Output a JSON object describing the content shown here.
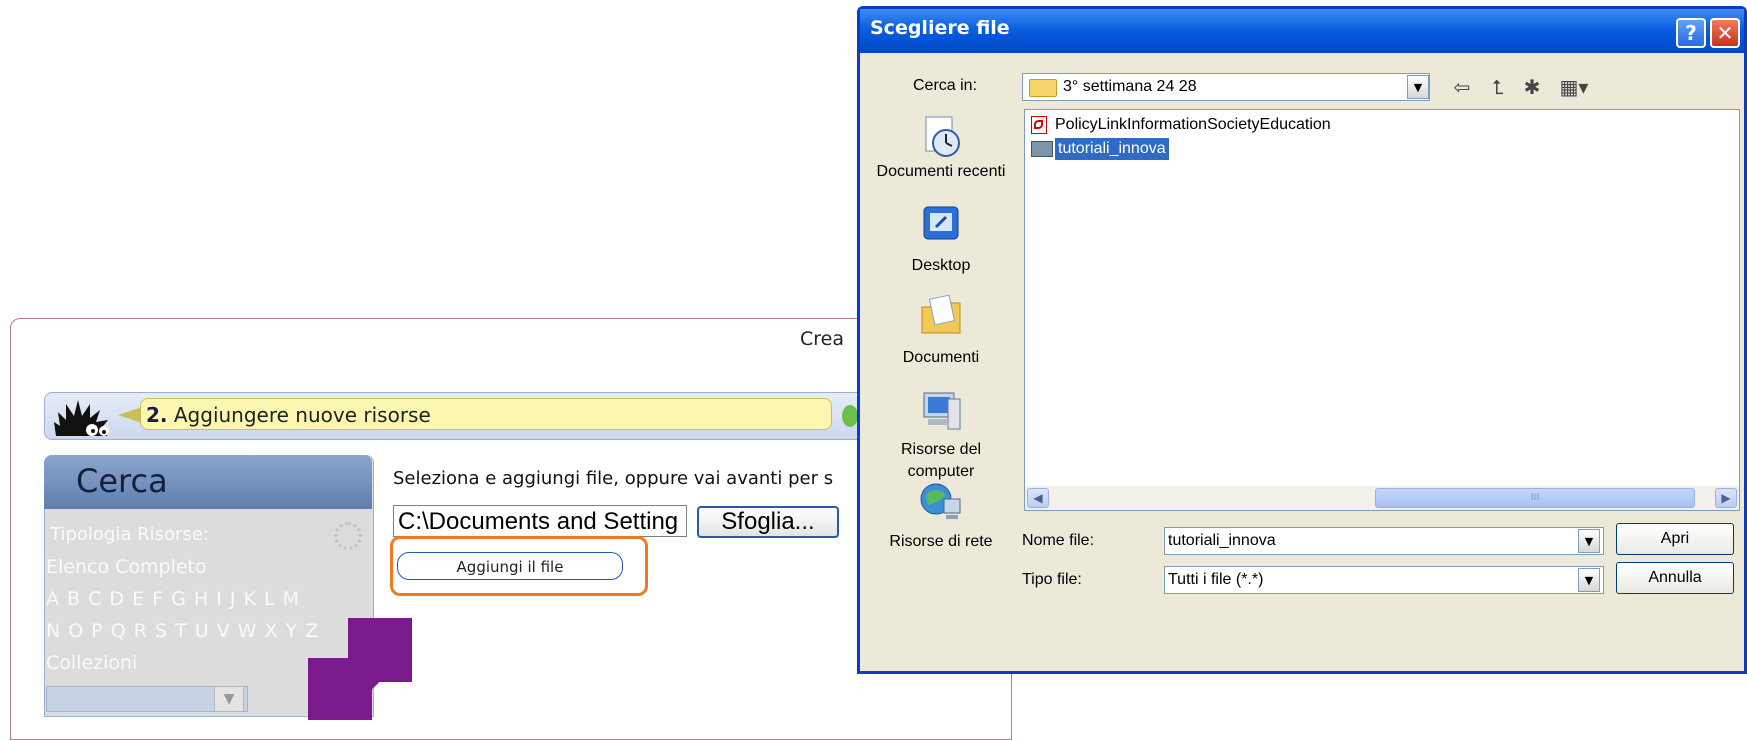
{
  "app": {
    "title": "Crea",
    "step_number": "2.",
    "step_label": "Aggiungere nuove risorse",
    "search": {
      "title": "Cerca",
      "type_label": "Tipologia Risorse:",
      "full_list": "Elenco Completo",
      "letters_row1": "A B C D E F G H I J  K L M",
      "letters_row2": "N O P Q R S T U V W X Y Z",
      "collections": "Collezioni"
    },
    "instruction": "Seleziona e aggiungi file, oppure vai avanti per s",
    "path_value": "C:\\Documents and Setting",
    "browse_label": "Sfoglia...",
    "add_file_label": "Aggiungi il file",
    "colors": {
      "highlight": "#f27921",
      "arrow": "#7a1a8c"
    }
  },
  "dialog": {
    "title": "Scegliere file",
    "help_glyph": "?",
    "close_glyph": "✕",
    "look_in_label": "Cerca in:",
    "look_in_value": "3° settimana 24 28",
    "places": [
      {
        "label": "Documenti recenti",
        "icon": "recent-documents-icon"
      },
      {
        "label": "Desktop",
        "icon": "desktop-icon"
      },
      {
        "label": "Documenti",
        "icon": "documents-folder-icon"
      },
      {
        "label": "Risorse del computer",
        "icon": "my-computer-icon"
      },
      {
        "label": "Risorse di rete",
        "icon": "network-icon"
      }
    ],
    "files": [
      {
        "name": "PolicyLinkInformationSocietyEducation",
        "icon": "pdf-icon",
        "selected": false
      },
      {
        "name": "tutoriali_innova",
        "icon": "folder-icon",
        "selected": true
      }
    ],
    "scroll_thumb_glyph": "III",
    "file_name_label": "Nome file:",
    "file_name_value": "tutoriali_innova",
    "file_type_label": "Tipo file:",
    "file_type_value": "Tutti i file (*.*)",
    "open_label": "Apri",
    "cancel_label": "Annulla"
  }
}
